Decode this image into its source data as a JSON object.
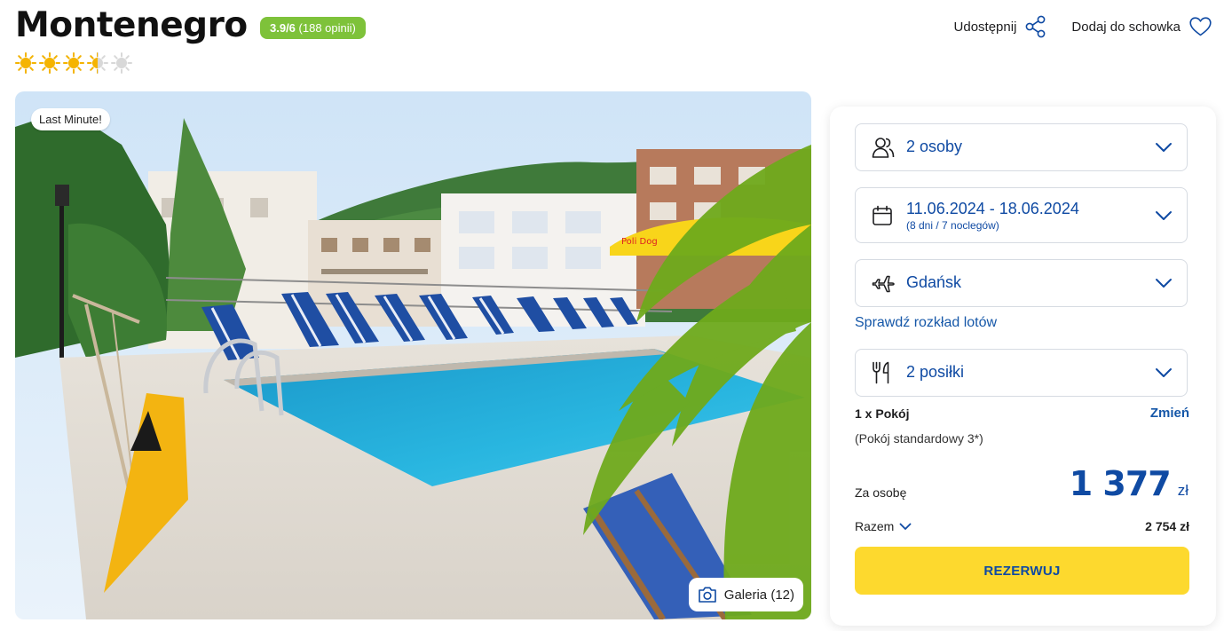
{
  "hotel": {
    "title": "Montenegro",
    "rating_score": "3.9/6",
    "rating_count": "(188 opinii)",
    "stars": 3.5,
    "stars_max": 5
  },
  "actions": {
    "share_label": "Udostępnij",
    "share_icon": "share-icon",
    "favorite_label": "Dodaj do schowka",
    "favorite_icon": "heart-icon"
  },
  "photo": {
    "badge": "Last Minute!",
    "gallery_label": "Galeria (12)",
    "gallery_icon": "camera-icon",
    "banner_text": "Poli Dog"
  },
  "booking": {
    "travelers": "2 osoby",
    "dates": "11.06.2024 - 18.06.2024",
    "duration": "(8 dni / 7 noclegów)",
    "departure": "Gdańsk",
    "schedule_link": "Sprawdź rozkład lotów",
    "meals": "2 posiłki",
    "room_count": "1 x Pokój",
    "room_change": "Zmień",
    "room_type": "(Pokój standardowy 3*)",
    "per_person_label": "Za osobę",
    "price_per_person": "1 377",
    "currency": "zł",
    "total_label": "Razem",
    "total_value": "2 754 zł",
    "book_button": "REZERWUJ"
  },
  "colors": {
    "brand_blue": "#0f4aa3",
    "rating_green": "#7ec23a",
    "book_yellow": "#fdd92e",
    "star_sun": "#f5b400"
  }
}
